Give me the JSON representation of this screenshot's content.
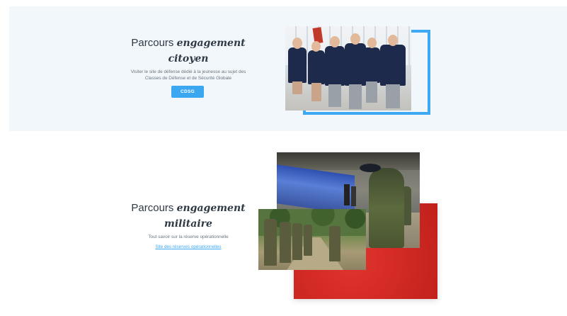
{
  "citizen": {
    "title_plain": "Parcours",
    "title_accent_1": "engagement",
    "title_accent_2": "citoyen",
    "description_line1": "Visiter le site de défense dédié à la jeunesse au sujet des",
    "description_line2": "Classes de Défense et de Sécurité Globale",
    "button_label": "CDSG"
  },
  "military": {
    "title_plain": "Parcours",
    "title_accent_1": "engagement",
    "title_accent_2": "militaire",
    "description": "Tout savoir sur la réserve opérationnelle",
    "link_label": "Site des réserves opérationnelles"
  },
  "colors": {
    "section_bg": "#f1f7fb",
    "accent_blue": "#3ba7f0",
    "accent_red": "#d32a24",
    "title_text": "#2f3a45"
  }
}
